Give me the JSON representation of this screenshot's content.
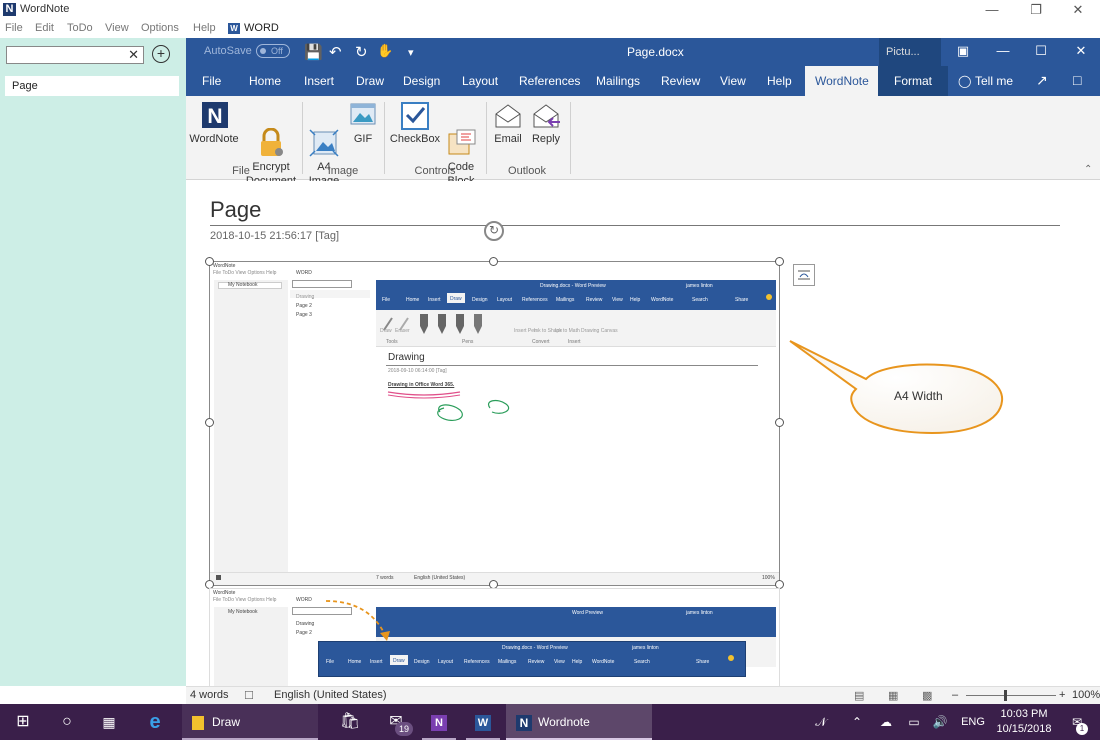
{
  "app": {
    "title": "WordNote"
  },
  "menu": {
    "items": [
      "File",
      "Edit",
      "ToDo",
      "View",
      "Options",
      "Help"
    ],
    "word_label": "WORD"
  },
  "sidebar": {
    "search_value": "",
    "pages": [
      "Page"
    ]
  },
  "word": {
    "autosave_label": "AutoSave",
    "autosave_state": "Off",
    "doc_title": "Page.docx",
    "context_tab": "Pictu...",
    "tabs": [
      "File",
      "Home",
      "Insert",
      "Draw",
      "Design",
      "Layout",
      "References",
      "Mailings",
      "Review",
      "View",
      "Help",
      "WordNote",
      "Format"
    ],
    "active_tab": "WordNote",
    "tell_me": "Tell me"
  },
  "ribbon": {
    "buttons": {
      "wordnote": "WordNote",
      "encrypt": "Encrypt\nDocument",
      "a4": "A4\nImage",
      "gif": "GIF",
      "checkbox": "CheckBox",
      "codeblock": "Code\nBlock",
      "email": "Email",
      "reply": "Reply"
    },
    "groups": {
      "file": "File",
      "image": "Image",
      "controls": "Controls",
      "outlook": "Outlook"
    }
  },
  "document": {
    "title": "Page",
    "date": "2018-10-15 21:56:17  [Tag]",
    "callout": "A4 Width",
    "inner": {
      "app_title": "WordNote",
      "menu": "File  ToDo  View  Options  Help",
      "word_label": "WORD",
      "notebook": "My Notebook",
      "pages": [
        "Drawing",
        "Page 2",
        "Page 3"
      ],
      "doc_title": "Drawing.docx  -  Word Preview",
      "user": "james linton",
      "tabs": [
        "File",
        "Home",
        "Insert",
        "Draw",
        "Design",
        "Layout",
        "References",
        "Mailings",
        "Review",
        "View",
        "Help",
        "WordNote",
        "Search",
        "Share"
      ],
      "groups": [
        "Tools",
        "Pens",
        "Convert",
        "Insert"
      ],
      "ribbon_labels": [
        "Draw",
        "Eraser",
        "Insert Pen",
        "Ink to Shape",
        "Ink to Math",
        "Drawing Canvas"
      ],
      "page_title": "Drawing",
      "page_date": "2018-09-10 06:14:00  [Tag]",
      "text": "Drawing in Office Word 365.",
      "status": "7 words",
      "language": "English (United States)",
      "zoom": "100%"
    },
    "inner2": {
      "doc_title": "Word Preview",
      "doc_title_2": "Drawing.docx  -  Word Preview"
    }
  },
  "statusbar": {
    "words": "4 words",
    "language": "English (United States)",
    "zoom": "100%"
  },
  "taskbar": {
    "draw": "Draw",
    "wordnote": "Wordnote",
    "mail_badge": "19",
    "lang": "ENG",
    "time": "10:03 PM",
    "date": "10/15/2018",
    "notif_count": "1"
  },
  "colors": {
    "word_blue": "#2b579a",
    "sidebar": "#cdeee6",
    "taskbar": "#3a1f4a",
    "callout_orange": "#e8951d"
  }
}
